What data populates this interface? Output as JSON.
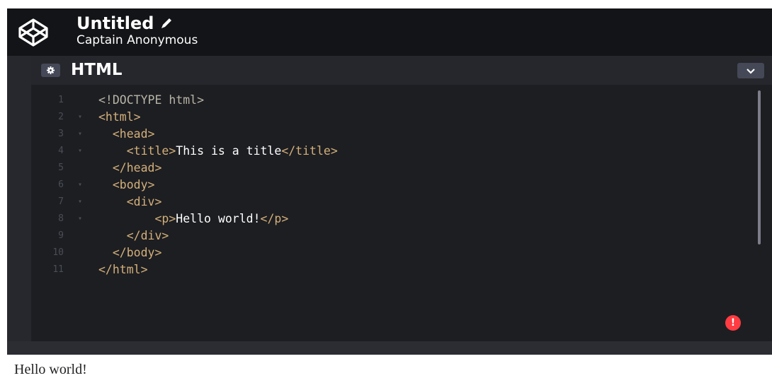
{
  "header": {
    "logo_icon": "codepen-logo-icon",
    "title": "Untitled",
    "edit_icon": "pencil-icon",
    "author": "Captain Anonymous"
  },
  "editor": {
    "settings_icon": "gear-icon",
    "title": "HTML",
    "collapse_icon": "chevron-down-icon",
    "lines": [
      {
        "num": "1",
        "fold": "",
        "code": "<!DOCTYPE html>"
      },
      {
        "num": "2",
        "fold": "▾",
        "code": "<html>"
      },
      {
        "num": "3",
        "fold": "▾",
        "code": "  <head>"
      },
      {
        "num": "4",
        "fold": "▾",
        "code": "    <title>This is a title</title>"
      },
      {
        "num": "5",
        "fold": "",
        "code": "  </head>"
      },
      {
        "num": "6",
        "fold": "▾",
        "code": "  <body>"
      },
      {
        "num": "7",
        "fold": "▾",
        "code": "    <div>"
      },
      {
        "num": "8",
        "fold": "▾",
        "code": "        <p>Hello world!</p>"
      },
      {
        "num": "9",
        "fold": "",
        "code": "    </div>"
      },
      {
        "num": "10",
        "fold": "",
        "code": "  </body>"
      },
      {
        "num": "11",
        "fold": "",
        "code": "</html>"
      }
    ],
    "error_badge": "!",
    "error_icon": "error-alert-icon"
  },
  "preview": {
    "text": "Hello world!"
  },
  "colors": {
    "topbar": "#131417",
    "editor_bg": "#1d1e22",
    "tag": "#d4b07a",
    "error": "#ff3c41"
  }
}
